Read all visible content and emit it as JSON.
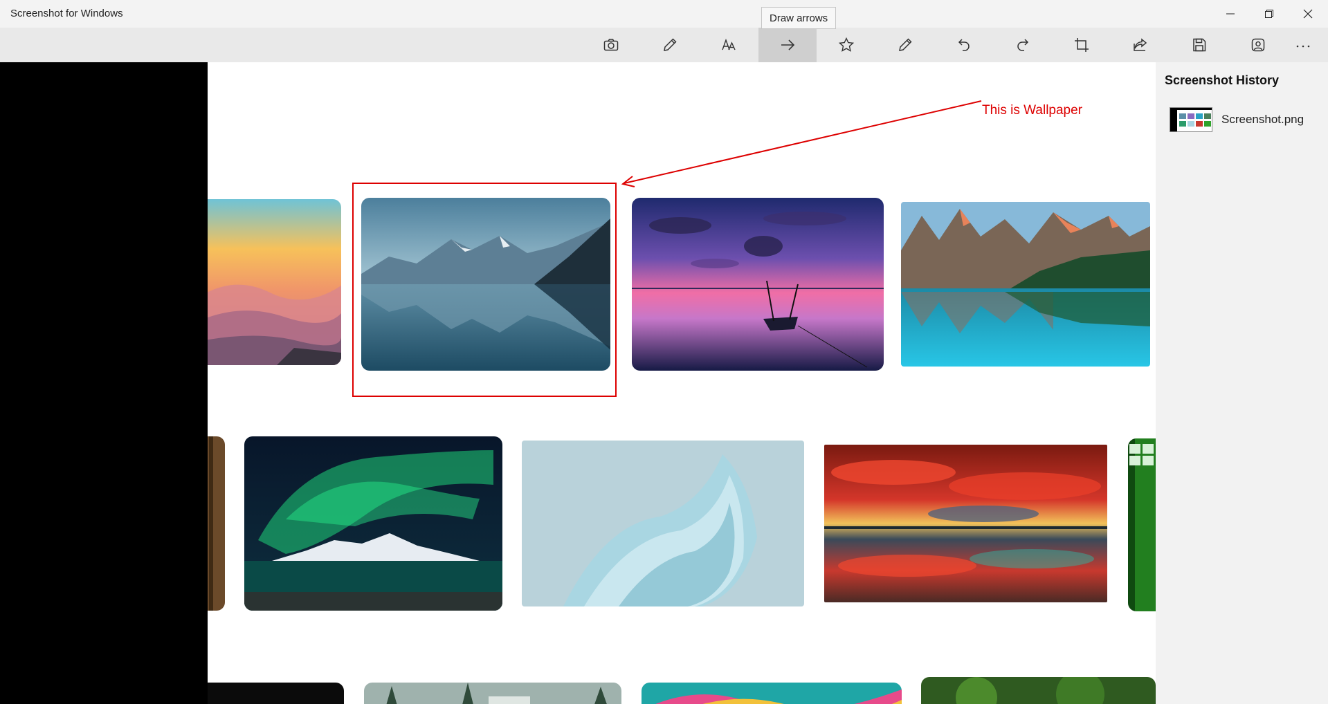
{
  "app": {
    "title": "Screenshot for Windows"
  },
  "window_controls": [
    {
      "name": "minimize-button",
      "icon": "minimize-icon"
    },
    {
      "name": "restore-button",
      "icon": "restore-icon"
    },
    {
      "name": "close-button",
      "icon": "close-icon"
    }
  ],
  "toolbar": {
    "tools": [
      {
        "name": "camera",
        "icon": "camera-icon"
      },
      {
        "name": "pen",
        "icon": "pencil-icon"
      },
      {
        "name": "text",
        "icon": "text-icon"
      },
      {
        "name": "draw-arrows",
        "icon": "arrow-right-icon",
        "active": true
      },
      {
        "name": "star",
        "icon": "star-icon"
      },
      {
        "name": "highlighter",
        "icon": "pencil-icon"
      },
      {
        "name": "undo",
        "icon": "undo-icon"
      },
      {
        "name": "redo",
        "icon": "redo-icon"
      },
      {
        "name": "crop",
        "icon": "crop-icon"
      },
      {
        "name": "share",
        "icon": "share-icon"
      },
      {
        "name": "save",
        "icon": "save-icon"
      },
      {
        "name": "open-image",
        "icon": "image-icon"
      },
      {
        "name": "more",
        "icon": "more-icon"
      }
    ],
    "tooltip": "Draw arrows"
  },
  "annotation": {
    "label": "This is Wallpaper",
    "color": "#dd0000"
  },
  "sidebar": {
    "title": "Screenshot History",
    "items": [
      {
        "label": "Screenshot.png"
      }
    ]
  },
  "colors": {
    "titlebar_bg": "#f3f3f3",
    "toolbar_bg": "#e9e9e9",
    "active_tool_bg": "#cfcfcf",
    "annotation_red": "#dd0000",
    "sidebar_bg": "#f2f2f2"
  }
}
